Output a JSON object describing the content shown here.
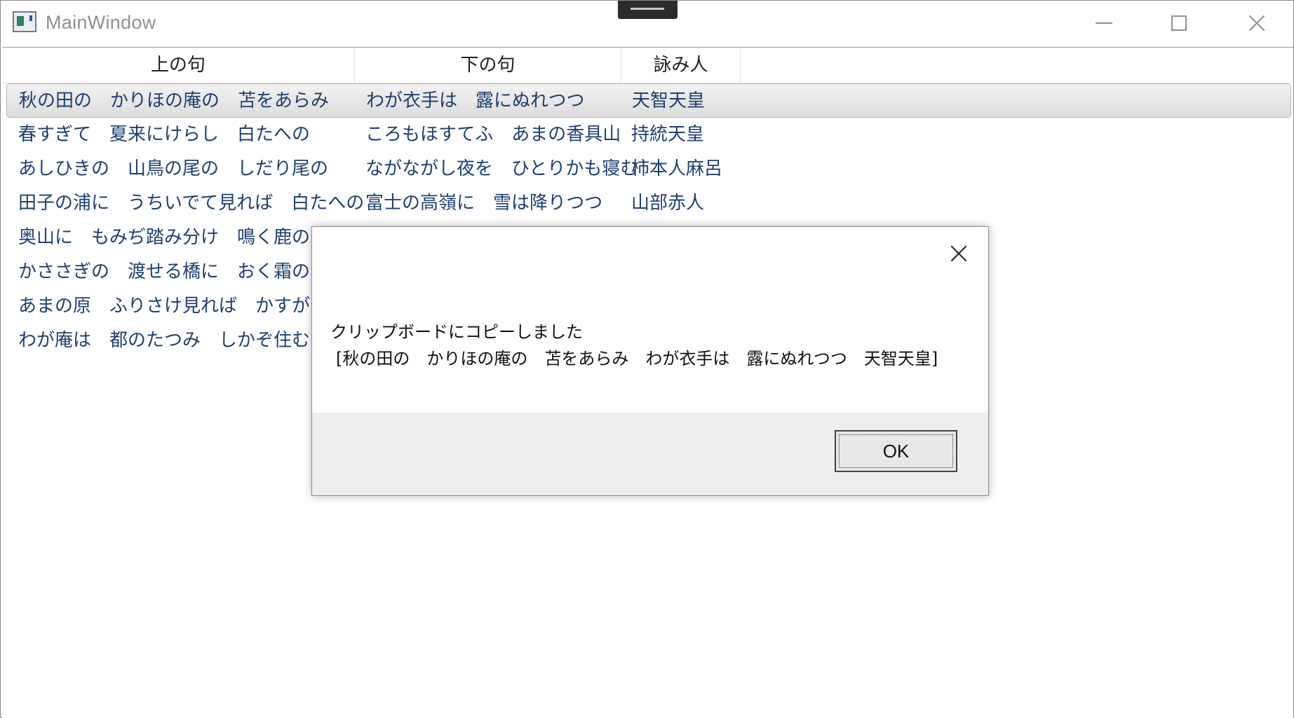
{
  "window": {
    "title": "MainWindow"
  },
  "list": {
    "headers": [
      "上の句",
      "下の句",
      "詠み人"
    ],
    "rows": [
      {
        "kami": "秋の田の　かりほの庵の　苫をあらみ",
        "shimo": "わが衣手は　露にぬれつつ",
        "author": "天智天皇"
      },
      {
        "kami": "春すぎて　夏来にけらし　白たへの",
        "shimo": "ころもほすてふ　あまの香具山",
        "author": "持統天皇"
      },
      {
        "kami": "あしひきの　山鳥の尾の　しだり尾の",
        "shimo": "ながながし夜を　ひとりかも寝む",
        "author": "柿本人麻呂"
      },
      {
        "kami": "田子の浦に　うちいでて見れば　白たへの",
        "shimo": "富士の高嶺に　雪は降りつつ",
        "author": "山部赤人"
      },
      {
        "kami": "奥山に　もみぢ踏み分け　鳴く鹿の",
        "shimo": "",
        "author": ""
      },
      {
        "kami": "かささぎの　渡せる橋に　おく霜の",
        "shimo": "",
        "author": ""
      },
      {
        "kami": "あまの原　ふりさけ見れば　かすがなる",
        "shimo": "",
        "author": ""
      },
      {
        "kami": "わが庵は　都のたつみ　しかぞ住む",
        "shimo": "",
        "author": ""
      }
    ]
  },
  "dialog": {
    "message_line1": "クリップボードにコピーしました",
    "message_line2": "[秋の田の　かりほの庵の　苫をあらみ　わが衣手は　露にぬれつつ　天智天皇]",
    "ok_label": "OK"
  }
}
